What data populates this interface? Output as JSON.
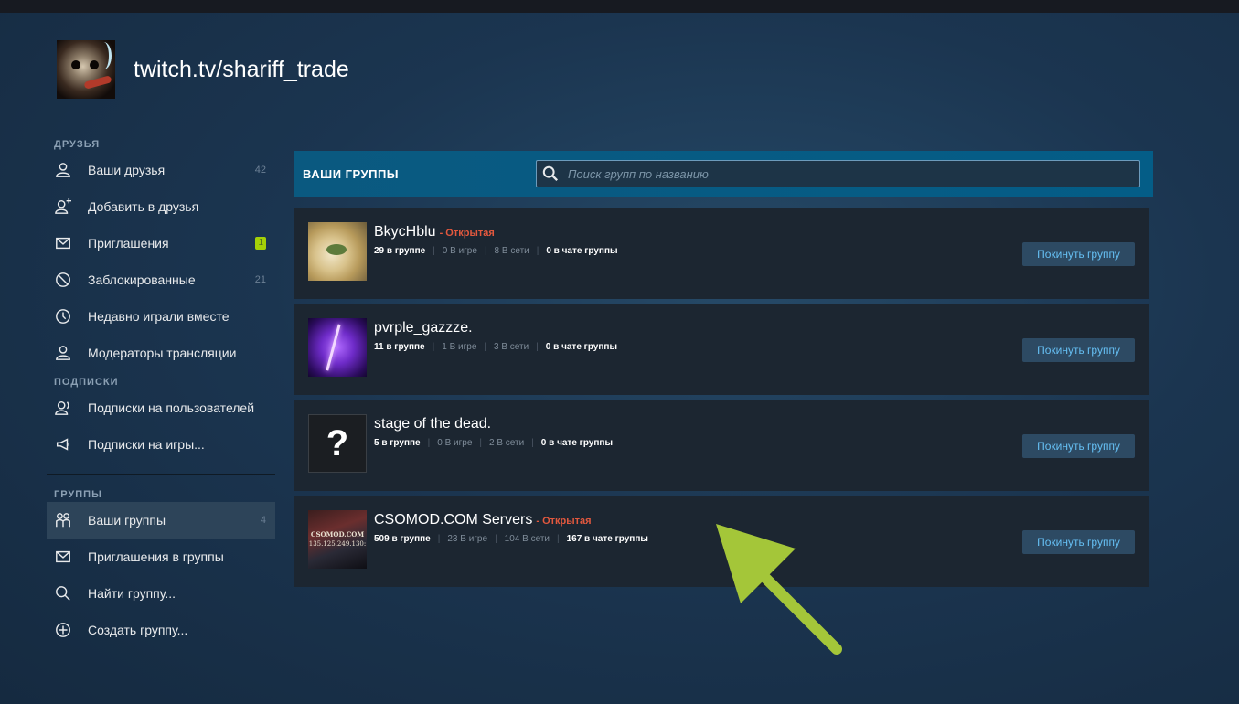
{
  "profile": {
    "name": "twitch.tv/shariff_trade"
  },
  "sidebar": {
    "friends_title": "ДРУЗЬЯ",
    "friends": [
      {
        "label": "Ваши друзья",
        "count": "42",
        "icon": "person-icon"
      },
      {
        "label": "Добавить в друзья",
        "icon": "person-add-icon"
      },
      {
        "label": "Приглашения",
        "badge": "1",
        "icon": "envelope-icon"
      },
      {
        "label": "Заблокированные",
        "count": "21",
        "icon": "blocked-icon"
      },
      {
        "label": "Недавно играли вместе",
        "icon": "clock-icon"
      },
      {
        "label": "Модераторы трансляции",
        "icon": "person-icon"
      }
    ],
    "subs_title": "ПОДПИСКИ",
    "subs": [
      {
        "label": "Подписки на пользователей",
        "icon": "person-broadcast-icon"
      },
      {
        "label": "Подписки на игры...",
        "icon": "megaphone-icon"
      }
    ],
    "groups_title": "ГРУППЫ",
    "groups": [
      {
        "label": "Ваши группы",
        "count": "4",
        "icon": "people-icon"
      },
      {
        "label": "Приглашения в группы",
        "icon": "envelope-icon"
      },
      {
        "label": "Найти группу...",
        "icon": "search-icon"
      },
      {
        "label": "Создать группу...",
        "icon": "plus-circle-icon"
      }
    ]
  },
  "main": {
    "title": "ВАШИ ГРУППЫ",
    "search_placeholder": "Поиск групп по названию",
    "leave_label": "Покинуть группу",
    "groups": [
      {
        "name": "BkycHblu",
        "open": "- Открытая",
        "members": "29 в группе",
        "ingame": "0 В игре",
        "online": "8 В сети",
        "chat": "0 в чате группы"
      },
      {
        "name": "pvrple_gazzze.",
        "open": "",
        "members": "11 в группе",
        "ingame": "1 В игре",
        "online": "3 В сети",
        "chat": "0 в чате группы"
      },
      {
        "name": "stage of the dead.",
        "open": "",
        "members": "5 в группе",
        "ingame": "0 В игре",
        "online": "2 В сети",
        "chat": "0 в чате группы"
      },
      {
        "name": "CSOMOD.COM Servers",
        "open": "- Открытая",
        "members": "509 в группе",
        "ingame": "23 В игре",
        "online": "104 В сети",
        "chat": "167 в чате группы"
      }
    ],
    "avatar3_glyph": "?",
    "avatar4_text1": "CSOMOD.COM",
    "avatar4_text2": "135.125.249.130:"
  },
  "colors": {
    "accent_header": "#045d87",
    "leave_text": "#66c0f4",
    "open_label": "#e2583e",
    "arrow": "#a4c639",
    "badge": "#a4d007"
  }
}
